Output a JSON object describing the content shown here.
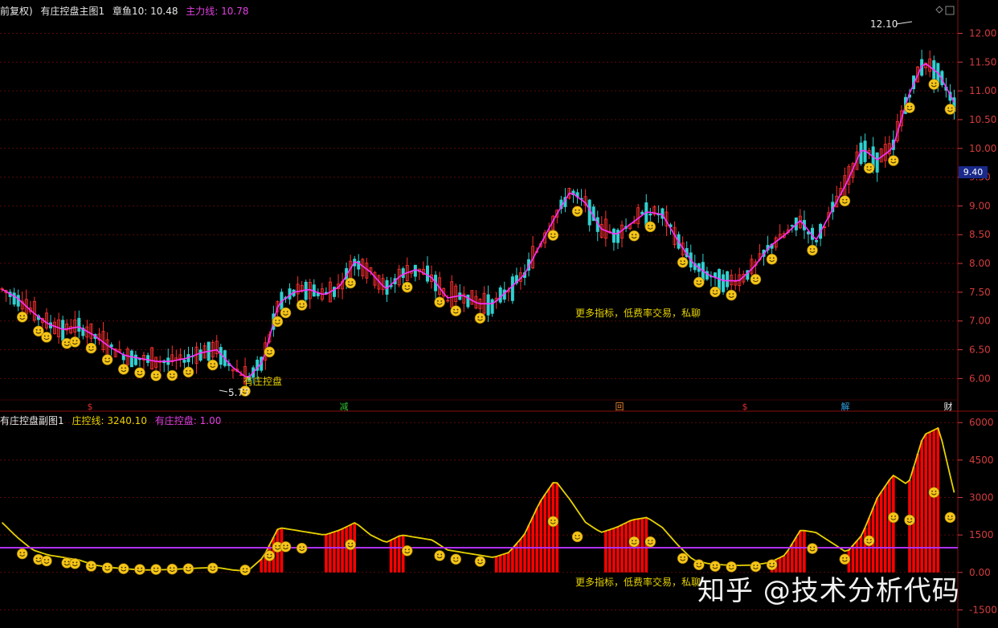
{
  "main": {
    "adjust_label": "前复权)",
    "indicator_name": "有庄控盘主图1",
    "stock_label": "章鱼10: 10.48",
    "line_label": "主力线: 10.78",
    "max_label": "12.10",
    "min_label": "5.77",
    "signal_label": "有庄控盘",
    "ad_text": "更多指标，低费率交易，私聊",
    "current_price": "9.40",
    "yticks": [
      "12.00",
      "11.50",
      "11.00",
      "10.50",
      "10.00",
      "9.50",
      "9.00",
      "8.50",
      "8.00",
      "7.50",
      "7.00",
      "6.50",
      "6.00"
    ]
  },
  "markers": [
    {
      "label": "$",
      "color": "#e03030"
    },
    {
      "label": "减",
      "color": "#30c030"
    },
    {
      "label": "回",
      "color": "#e08030"
    },
    {
      "label": "$",
      "color": "#e03030"
    },
    {
      "label": "解",
      "color": "#30a0e0"
    },
    {
      "label": "财",
      "color": "#e6e6e6"
    }
  ],
  "sub": {
    "indicator_name": "有庄控盘副图1",
    "line1_label": "庄控线: 3240.10",
    "line2_label": "有庄控盘: 1.00",
    "ad_text": "更多指标，低费率交易，私聊",
    "yticks": [
      "6000",
      "4500",
      "3000",
      "1500",
      "0.00",
      "-1500"
    ]
  },
  "watermark": "知乎 @技术分析代码",
  "colors": {
    "up": "#ff3030",
    "down": "#30d0d0",
    "ma": "#ff30ff",
    "sub_line": "#e6d200",
    "bar": "#ff0000",
    "zero": "#b030ff",
    "smiley": "#f5c518"
  },
  "chart_data": [
    {
      "type": "line",
      "title": "有庄控盘主图1",
      "ylim": [
        5.6,
        12.3
      ],
      "series": [
        {
          "name": "主力线",
          "values": [
            7.55,
            7.4,
            7.15,
            6.95,
            6.85,
            6.9,
            6.75,
            6.55,
            6.4,
            6.35,
            6.3,
            6.3,
            6.35,
            6.45,
            6.5,
            6.2,
            6.0,
            6.3,
            7.3,
            7.5,
            7.55,
            7.45,
            7.6,
            8.05,
            7.85,
            7.55,
            7.8,
            7.9,
            7.75,
            7.4,
            7.45,
            7.3,
            7.3,
            7.55,
            7.8,
            8.3,
            8.8,
            9.25,
            9.05,
            8.6,
            8.5,
            8.7,
            8.9,
            8.85,
            8.4,
            8.0,
            7.8,
            7.7,
            7.7,
            7.95,
            8.3,
            8.5,
            8.75,
            8.4,
            8.9,
            9.4,
            10.0,
            9.8,
            10.0,
            10.9,
            11.5,
            11.3,
            10.8
          ]
        }
      ],
      "min_label": 5.77,
      "max_label": 12.1
    },
    {
      "type": "bar",
      "title": "有庄控盘副图1",
      "ylim": [
        -2000,
        6200
      ],
      "series": [
        {
          "name": "庄控线",
          "values": [
            2000,
            1400,
            900,
            700,
            600,
            500,
            300,
            200,
            150,
            100,
            100,
            120,
            150,
            180,
            200,
            100,
            50,
            600,
            1800,
            1700,
            1600,
            1500,
            1700,
            2000,
            1500,
            1200,
            1500,
            1400,
            1300,
            900,
            800,
            700,
            600,
            800,
            1500,
            2800,
            3700,
            2900,
            2000,
            1600,
            1800,
            2100,
            2200,
            1800,
            1100,
            500,
            350,
            300,
            280,
            300,
            400,
            700,
            1700,
            1600,
            1200,
            800,
            1500,
            3000,
            3900,
            3500,
            5500,
            5800,
            3200
          ]
        }
      ]
    }
  ]
}
